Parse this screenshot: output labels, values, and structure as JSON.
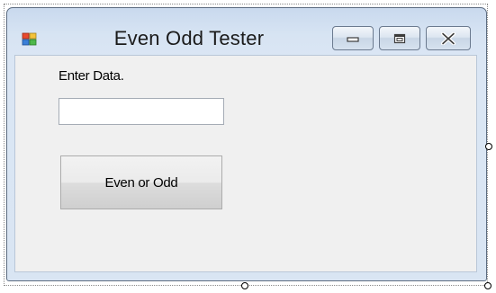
{
  "window": {
    "title": "Even Odd Tester",
    "icon": "form-icon",
    "controls": {
      "minimize_icon": "minimize-icon",
      "maximize_icon": "maximize-icon",
      "close_icon": "close-icon"
    }
  },
  "form": {
    "label": "Enter Data.",
    "input_value": "",
    "button_label": "Even or Odd"
  },
  "designer": {
    "resize_handles": [
      "right-resize-handle",
      "bottom-resize-handle",
      "corner-resize-handle"
    ]
  },
  "colors": {
    "titlebar": "#d7e4f3",
    "client_background": "#f0f0f0",
    "border": "#5b6b80"
  }
}
